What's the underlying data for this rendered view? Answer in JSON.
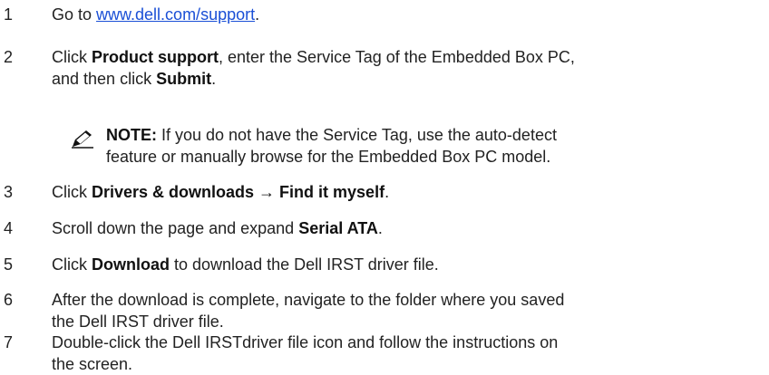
{
  "steps": [
    {
      "number": "1",
      "before": "Go to ",
      "link": "www.dell.com/support",
      "after": "."
    },
    {
      "number": "2",
      "t1": "Click ",
      "b1": "Product support",
      "t2": ", enter the Service Tag of the Embedded Box PC,",
      "t3": "and then click ",
      "b2": "Submit",
      "t4": "."
    },
    {
      "number": "3",
      "t1": "Click ",
      "b1": "Drivers & downloads → Find it myself",
      "t2": "."
    },
    {
      "number": "4",
      "t1": "Scroll down the page and expand ",
      "b1": "Serial ATA",
      "t2": "."
    },
    {
      "number": "5",
      "t1": "Click ",
      "b1": "Download",
      "t2": " to download the Dell IRST driver file."
    },
    {
      "number": "6",
      "line1": "After the download is complete, navigate to the folder where you saved",
      "line2": "the Dell IRST driver file."
    },
    {
      "number": "7",
      "line1": "Double-click the Dell IRSTdriver file icon and follow the instructions on",
      "line2": "the screen."
    }
  ],
  "note": {
    "label": "NOTE:",
    "line1": " If you do not have the Service Tag, use the auto-detect",
    "line2": "feature or manually browse for the Embedded Box PC model.",
    "icon": "pencil-note-icon"
  }
}
